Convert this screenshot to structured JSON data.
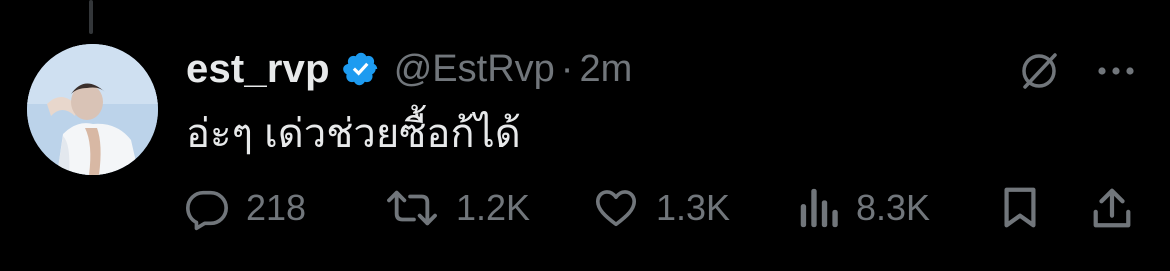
{
  "tweet": {
    "display_name": "est_rvp",
    "handle": "@EstRvp",
    "separator": "·",
    "time": "2m",
    "text": "อ่ะๆ เด่วช่วยซื้อก้ได้",
    "verified": true
  },
  "actions": {
    "replies": "218",
    "reposts": "1.2K",
    "likes": "1.3K",
    "views": "8.3K"
  },
  "icons": {
    "verified": "verified-badge-icon",
    "grok": "grok-icon",
    "more": "more-icon",
    "reply": "reply-icon",
    "repost": "repost-icon",
    "like": "heart-icon",
    "views": "views-chart-icon",
    "bookmark": "bookmark-icon",
    "share": "share-icon"
  },
  "colors": {
    "background": "#000000",
    "text_primary": "#e7e9ea",
    "text_secondary": "#71767b",
    "verified_blue": "#1d9bf0",
    "thread_line": "#333639"
  }
}
